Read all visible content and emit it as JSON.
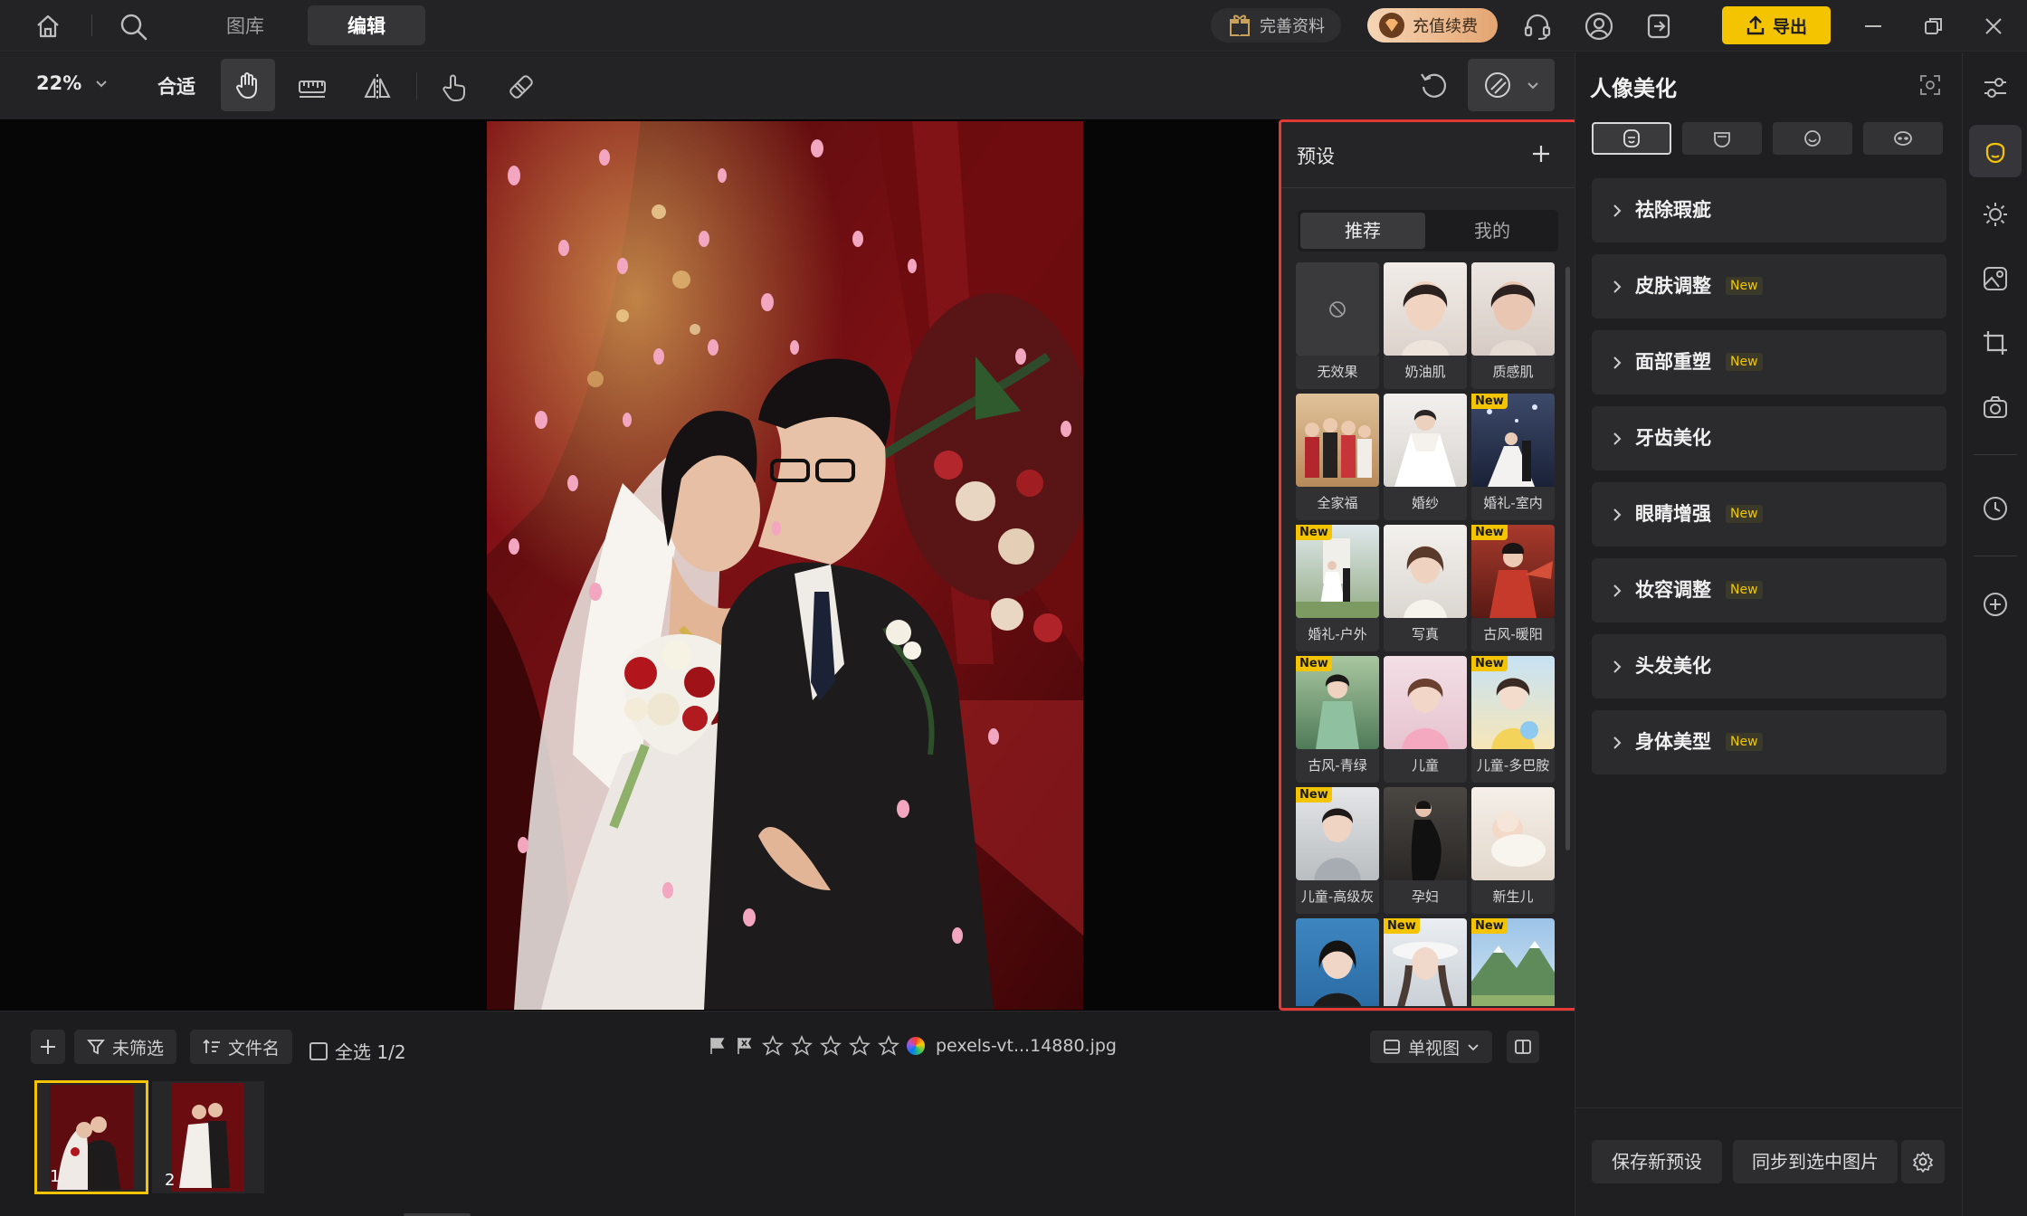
{
  "topbar": {
    "tabs": [
      {
        "label": "图库"
      },
      {
        "label": "编辑"
      }
    ],
    "profile_label": "完善资料",
    "vip_label": "充值续费",
    "export_label": "导出"
  },
  "toolbar": {
    "zoom": "22%",
    "fit_label": "合适"
  },
  "preset_panel": {
    "title": "预设",
    "tabs": [
      {
        "label": "推荐"
      },
      {
        "label": "我的"
      }
    ],
    "new_tag": "New",
    "items": [
      {
        "label": "无效果",
        "is_new": false
      },
      {
        "label": "奶油肌",
        "is_new": false
      },
      {
        "label": "质感肌",
        "is_new": false
      },
      {
        "label": "全家福",
        "is_new": false
      },
      {
        "label": "婚纱",
        "is_new": false
      },
      {
        "label": "婚礼-室内",
        "is_new": true
      },
      {
        "label": "婚礼-户外",
        "is_new": true
      },
      {
        "label": "写真",
        "is_new": false
      },
      {
        "label": "古风-暖阳",
        "is_new": true
      },
      {
        "label": "古风-青绿",
        "is_new": true
      },
      {
        "label": "儿童",
        "is_new": false
      },
      {
        "label": "儿童-多巴胺",
        "is_new": true
      },
      {
        "label": "儿童-高级灰",
        "is_new": true
      },
      {
        "label": "孕妇",
        "is_new": false
      },
      {
        "label": "新生儿",
        "is_new": false
      },
      {
        "label": "",
        "is_new": false
      },
      {
        "label": "",
        "is_new": true
      },
      {
        "label": "",
        "is_new": true
      }
    ]
  },
  "right_panel": {
    "title": "人像美化",
    "new_tag": "New",
    "sections": [
      {
        "label": "祛除瑕疵",
        "is_new": false
      },
      {
        "label": "皮肤调整",
        "is_new": true
      },
      {
        "label": "面部重塑",
        "is_new": true
      },
      {
        "label": "牙齿美化",
        "is_new": false
      },
      {
        "label": "眼睛增强",
        "is_new": true
      },
      {
        "label": "妆容调整",
        "is_new": true
      },
      {
        "label": "头发美化",
        "is_new": false
      },
      {
        "label": "身体美型",
        "is_new": true
      }
    ],
    "save_preset_label": "保存新预设",
    "sync_label": "同步到选中图片"
  },
  "bottombar": {
    "filter_label": "未筛选",
    "sort_label": "文件名",
    "select_all_label": "全选 1/2",
    "filename": "pexels-vt...14880.jpg",
    "view_mode_label": "单视图",
    "filmstrip": [
      {
        "index": "1"
      },
      {
        "index": "2"
      }
    ]
  },
  "colors": {
    "accent_yellow": "#f5c400",
    "highlight_red": "#e53935",
    "new_badge_text": "#f2c800"
  }
}
